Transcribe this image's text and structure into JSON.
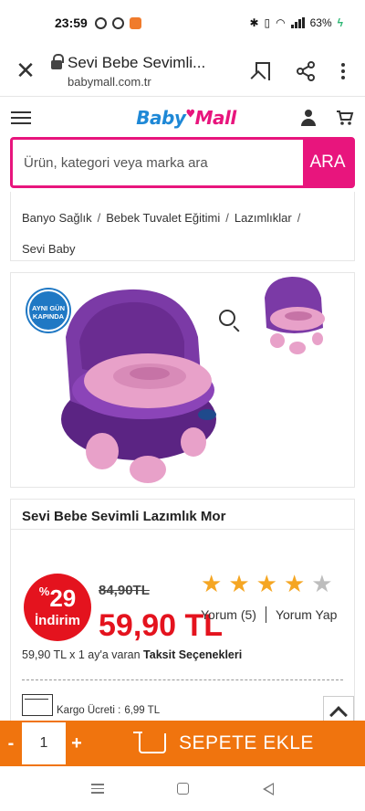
{
  "status_bar": {
    "time": "23:59",
    "battery": "63%",
    "icons": [
      "threads-icon",
      "instagram-icon",
      "app-icon",
      "bluetooth-icon",
      "vibrate-icon",
      "wifi-icon",
      "signal-icon",
      "battery-icon"
    ]
  },
  "browser": {
    "page_title": "Sevi Bebe Sevimli...",
    "url": "babymall.com.tr"
  },
  "site": {
    "logo_text_baby": "Baby",
    "logo_text_mall": "Mall"
  },
  "search": {
    "placeholder": "Ürün, kategori veya marka ara",
    "button_label": "ARA"
  },
  "breadcrumb": {
    "items": [
      "Banyo Sağlık",
      "Bebek Tuvalet Eğitimi",
      "Lazımlıklar",
      "Sevi Baby"
    ],
    "separator": "/"
  },
  "product": {
    "badge_line1": "AYNI GÜN",
    "badge_line2": "KAPINDA",
    "title": "Sevi Bebe Sevimli Lazımlık Mor",
    "discount_percent_symbol": "%",
    "discount_value": "29",
    "discount_label": "İndirim",
    "old_price": "84,90TL",
    "new_price": "59,90 TL",
    "rating": 4,
    "rating_max": 5,
    "reviews_label": "Yorum (5)",
    "write_review_label": "Yorum Yap",
    "installment_prefix": "59,90 TL x 1 ay'a varan",
    "installment_link": "Taksit Seçenekleri",
    "cargo_label": "Kargo Ücreti :",
    "cargo_price": "6,99 TL"
  },
  "cart_bar": {
    "minus": "-",
    "quantity": "1",
    "plus": "+",
    "add_to_cart_label": "SEPETE EKLE"
  },
  "colors": {
    "brand_pink": "#e8157d",
    "brand_blue": "#1e88d6",
    "discount_red": "#e4131e",
    "cart_orange": "#f0740e",
    "star_gold": "#f5a623",
    "product_purple": "#6a2c91",
    "product_pink": "#e8a1c9"
  }
}
